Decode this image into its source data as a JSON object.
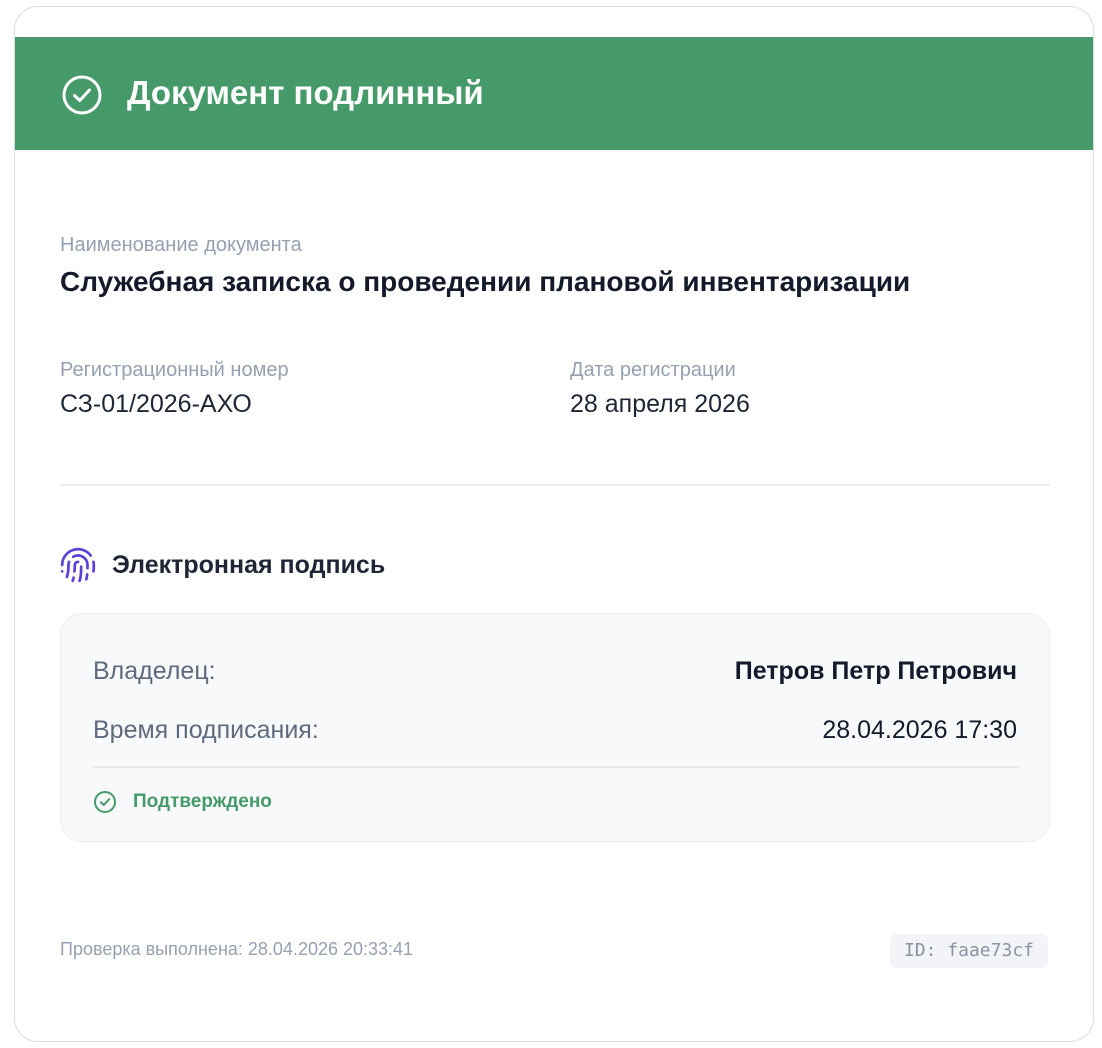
{
  "colors": {
    "accent": "#469a6a",
    "signature_icon": "#5b3fd6"
  },
  "header": {
    "icon": "check-circle-icon",
    "title": "Документ подлинный"
  },
  "document": {
    "name_label": "Наименование документа",
    "name_value": "Служебная записка о проведении плановой инвентаризации",
    "reg_number_label": "Регистрационный номер",
    "reg_number_value": "СЗ-01/2026-АХО",
    "reg_date_label": "Дата регистрации",
    "reg_date_value": "28 апреля 2026"
  },
  "signature": {
    "icon": "fingerprint-icon",
    "title": "Электронная подпись",
    "owner_label": "Владелец:",
    "owner_value": "Петров Петр Петрович",
    "time_label": "Время подписания:",
    "time_value": "28.04.2026 17:30",
    "status_icon": "check-circle-icon",
    "status": "Подтверждено"
  },
  "footer": {
    "checked_text": "Проверка выполнена: 28.04.2026 20:33:41",
    "id_text": "ID: faae73cf"
  }
}
